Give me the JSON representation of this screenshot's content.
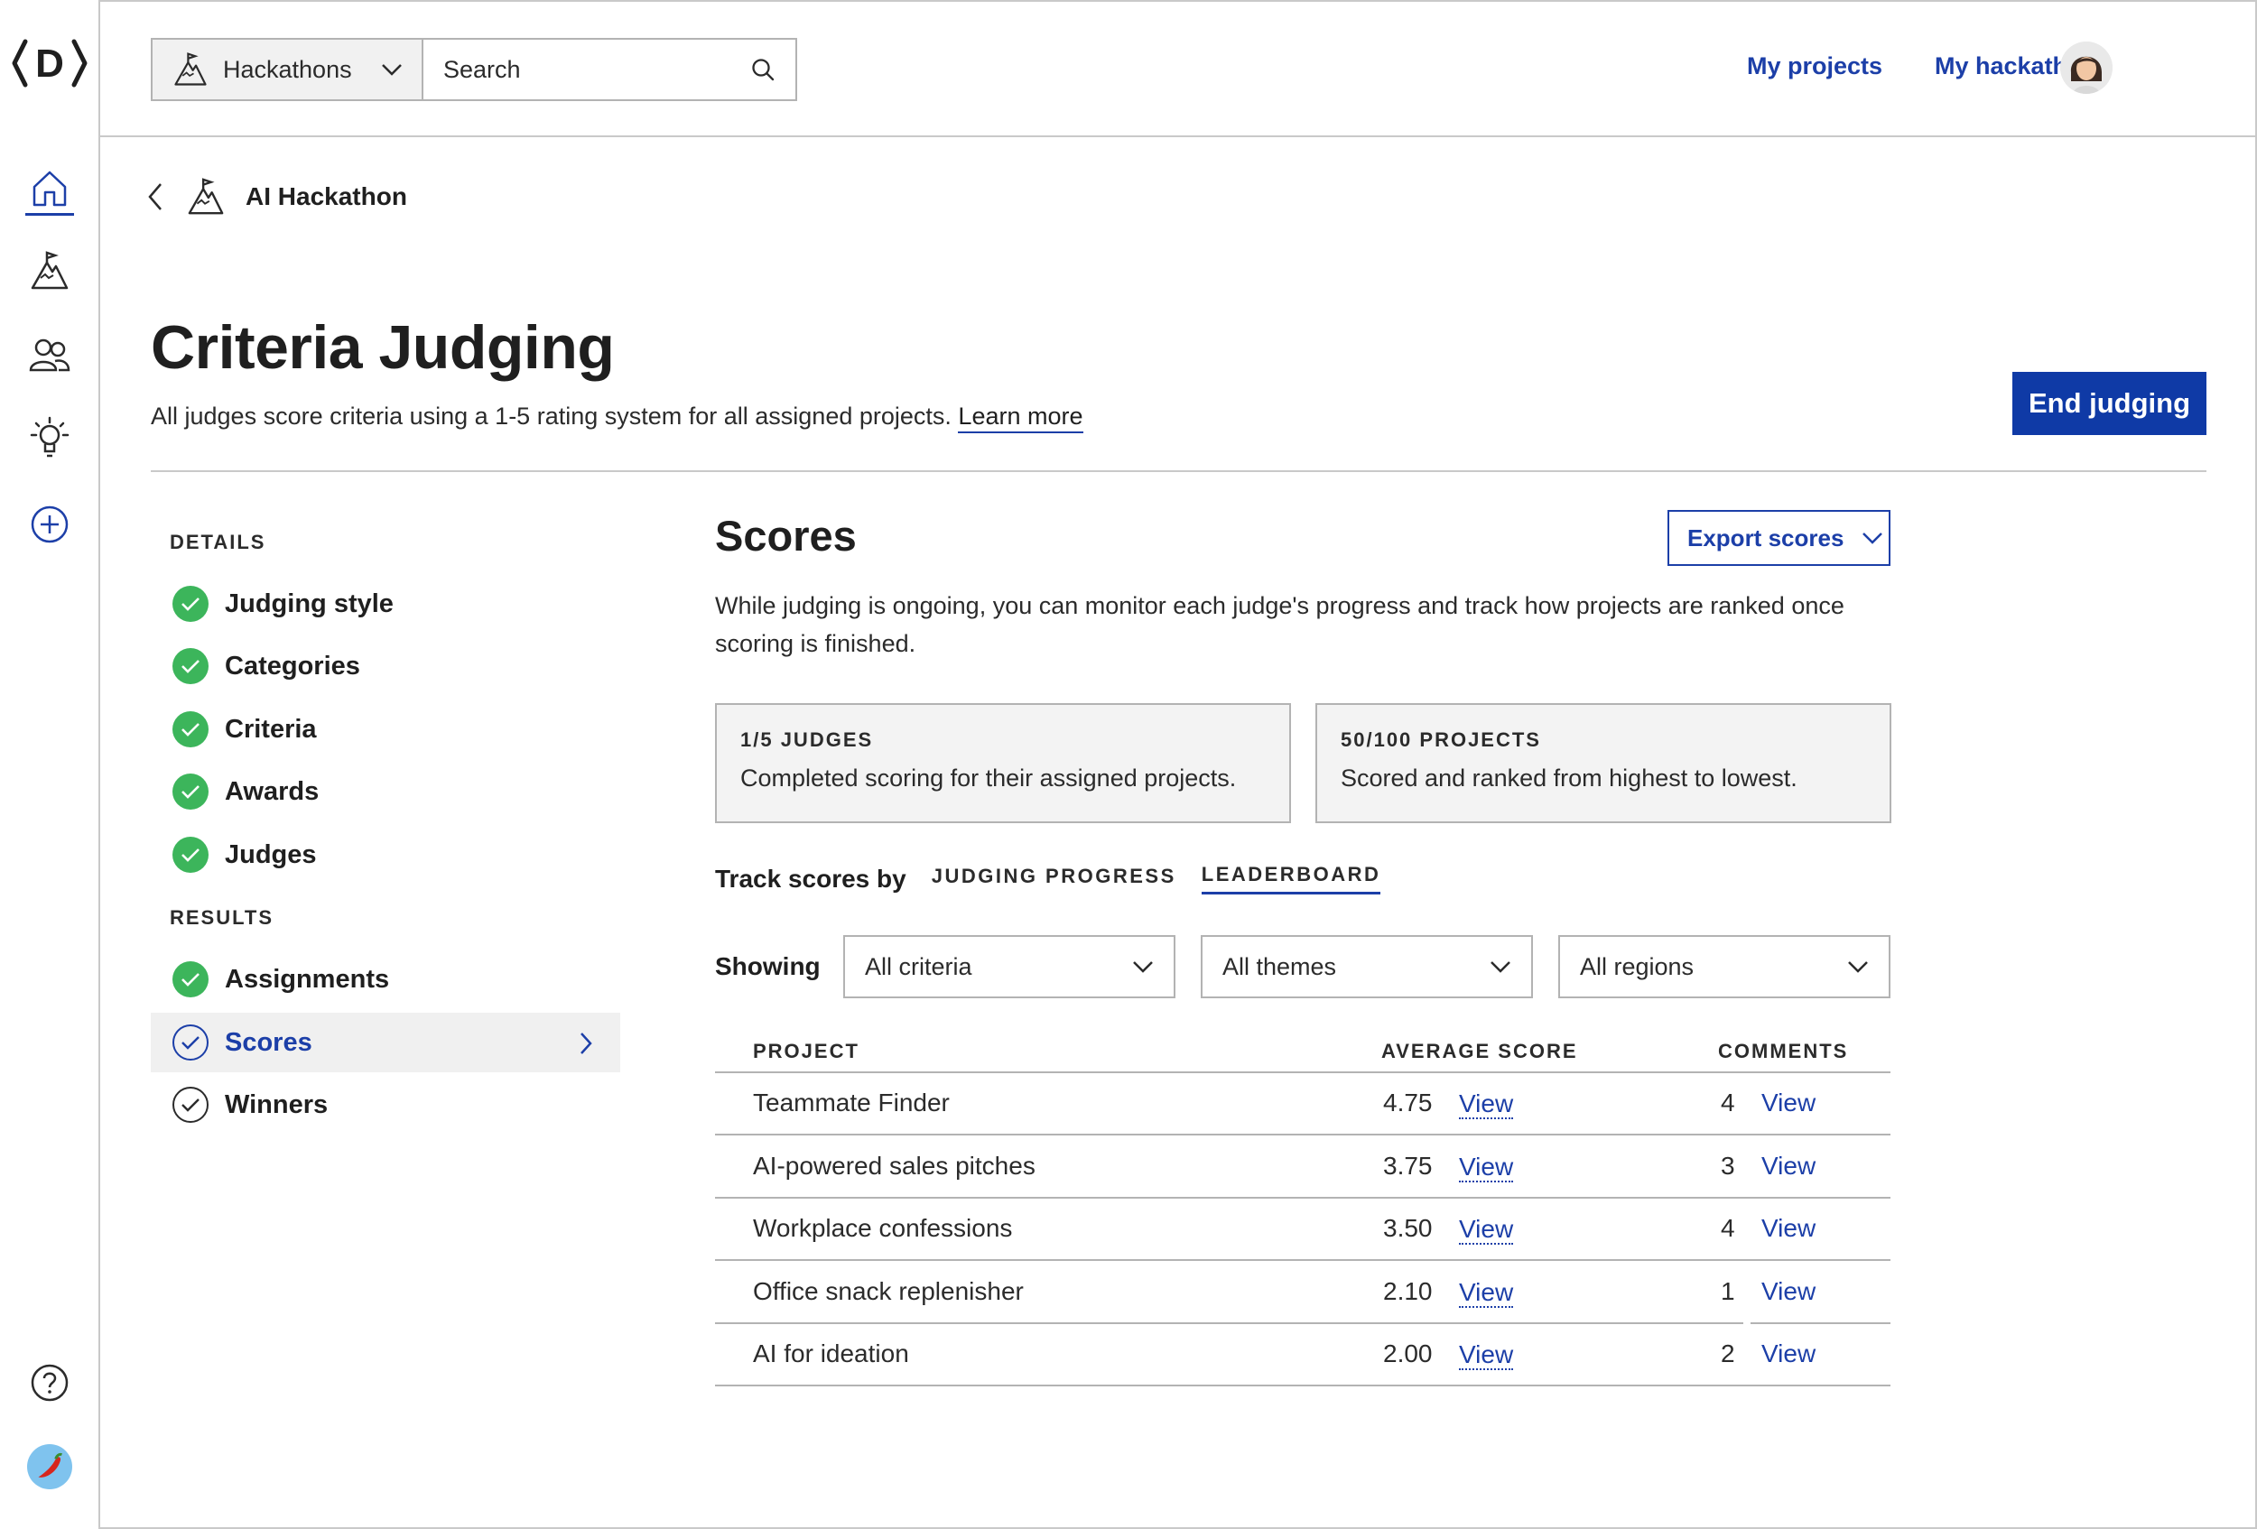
{
  "app": {
    "logo_text": "D"
  },
  "topbar": {
    "scope_select": "Hackathons",
    "search_placeholder": "Search",
    "links": [
      "My projects",
      "My hackathons"
    ]
  },
  "breadcrumb": {
    "label": "AI Hackathon"
  },
  "page": {
    "title": "Criteria Judging",
    "subtitle": "All judges score criteria using a 1-5 rating system for all assigned projects.",
    "learn_more": "Learn more",
    "end_button": "End judging"
  },
  "sidenav": {
    "details_heading": "DETAILS",
    "details": [
      "Judging style",
      "Categories",
      "Criteria",
      "Awards",
      "Judges"
    ],
    "results_heading": "RESULTS",
    "results": [
      "Assignments",
      "Scores",
      "Winners"
    ],
    "active": "Scores"
  },
  "main": {
    "heading": "Scores",
    "export_label": "Export scores",
    "description": "While judging is ongoing, you can monitor each judge's progress and track how projects are ranked once scoring is finished.",
    "cards": [
      {
        "kicker": "1/5 JUDGES",
        "text": "Completed scoring for their assigned projects."
      },
      {
        "kicker": "50/100 PROJECTS",
        "text": "Scored and ranked from highest to lowest."
      }
    ],
    "track_label": "Track scores by",
    "track_tabs": [
      "JUDGING PROGRESS",
      "LEADERBOARD"
    ],
    "active_tab": "LEADERBOARD",
    "showing_label": "Showing",
    "filters": [
      "All criteria",
      "All themes",
      "All regions"
    ]
  },
  "table": {
    "headers": {
      "project": "PROJECT",
      "average": "AVERAGE SCORE",
      "comments": "COMMENTS"
    },
    "link_label": "View",
    "rows": [
      {
        "project": "Teammate Finder",
        "score": "4.75",
        "comments": "4"
      },
      {
        "project": "AI-powered sales pitches",
        "score": "3.75",
        "comments": "3"
      },
      {
        "project": "Workplace confessions",
        "score": "3.50",
        "comments": "4"
      },
      {
        "project": "Office snack replenisher",
        "score": "2.10",
        "comments": "1"
      },
      {
        "project": "AI for ideation",
        "score": "2.00",
        "comments": "2"
      }
    ]
  },
  "colors": {
    "accent": "#1c3fa8",
    "primary_button": "#0f3aa6",
    "success": "#3cb55b",
    "border": "#c9c9c9"
  }
}
